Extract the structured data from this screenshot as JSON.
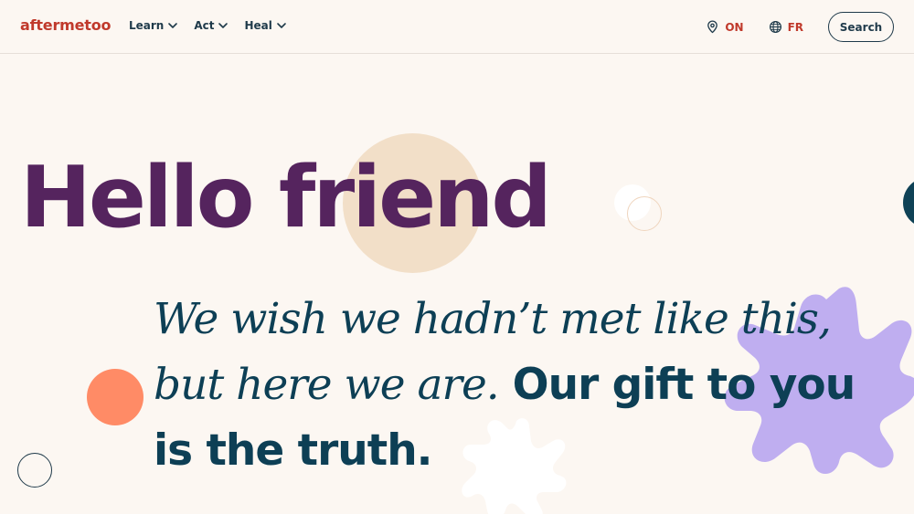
{
  "header": {
    "logo": "aftermetoo",
    "nav": [
      {
        "label": "Learn"
      },
      {
        "label": "Act"
      },
      {
        "label": "Heal"
      }
    ],
    "region": {
      "label": "ON",
      "icon": "location-pin-icon"
    },
    "language": {
      "label": "FR",
      "icon": "globe-icon"
    },
    "search_label": "Search"
  },
  "hero": {
    "title": "Hello friend",
    "line_italic_1": "We wish we hadn’t met like this,",
    "line_italic_2": "but here we are.",
    "line_bold": "Our gift to you is the truth."
  },
  "colors": {
    "brand_red": "#c0392b",
    "heading_purple": "#55245e",
    "body_navy": "#0d3f55",
    "background": "#fcf7f2",
    "accent_orange": "#ff8b66",
    "accent_lavender": "#bfaef0",
    "accent_peach": "#f2dfc8"
  }
}
